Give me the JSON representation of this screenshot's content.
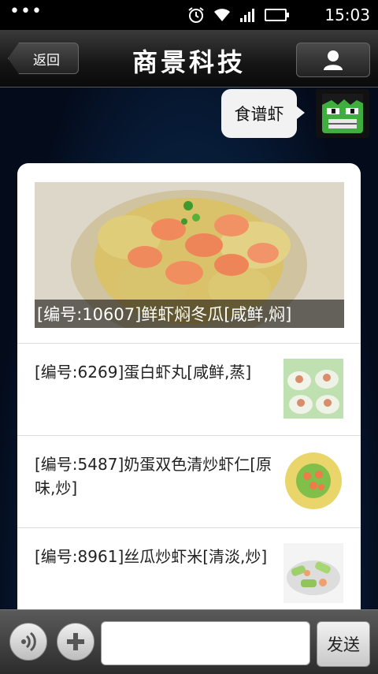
{
  "status_bar": {
    "dots": "•••",
    "time": "15:03",
    "icons": [
      "alarm-icon",
      "wifi-icon",
      "signal-icon",
      "battery-icon"
    ]
  },
  "header": {
    "back_label": "返回",
    "title": "商景科技",
    "profile_icon": "person-icon"
  },
  "chat": {
    "user_message": "食谱虾",
    "avatar_icon": "green-monster-avatar"
  },
  "results": {
    "featured": {
      "caption": "[编号:10607]鲜虾焖冬瓜[咸鲜,焖]",
      "image_icon": "shrimp-winter-melon-photo"
    },
    "items": [
      {
        "text": "[编号:6269]蛋白虾丸[咸鲜,蒸]",
        "image_icon": "shrimp-ball-photo"
      },
      {
        "text": "[编号:5487]奶蛋双色清炒虾仁[原味,炒]",
        "image_icon": "egg-shrimp-photo"
      },
      {
        "text": "[编号:8961]丝瓜炒虾米[清淡,炒]",
        "image_icon": "loofah-shrimp-photo"
      }
    ]
  },
  "input_bar": {
    "voice_icon": "voice-icon",
    "plus_icon": "plus-icon",
    "input_value": "",
    "input_placeholder": "",
    "send_label": "发送"
  },
  "colors": {
    "background": "#0b2a52",
    "titlebar": "#1a1a1a",
    "card": "#ffffff",
    "caption_overlay": "#000000"
  }
}
